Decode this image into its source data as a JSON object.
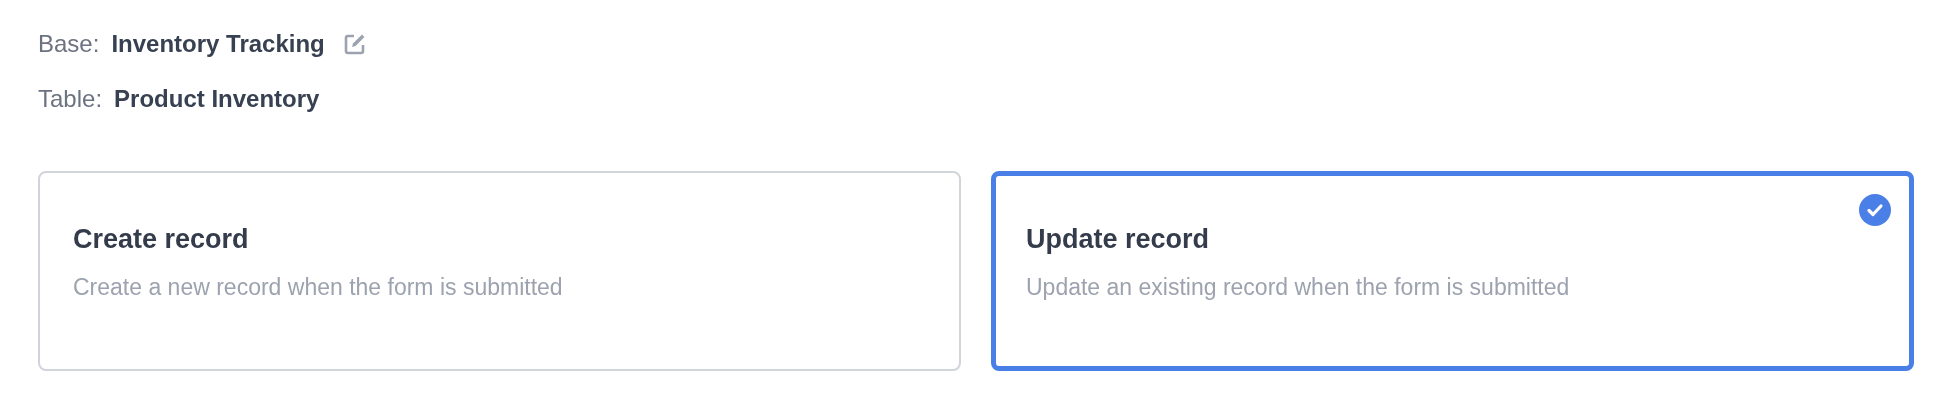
{
  "info": [
    {
      "label": "Base:",
      "value": "Inventory Tracking",
      "editable": true
    },
    {
      "label": "Table:",
      "value": "Product Inventory"
    }
  ],
  "options": [
    {
      "title": "Create record",
      "description": "Create a new record when the form is submitted",
      "selected": false
    },
    {
      "title": "Update record",
      "description": "Update an existing record when the form is submitted",
      "selected": true
    }
  ]
}
